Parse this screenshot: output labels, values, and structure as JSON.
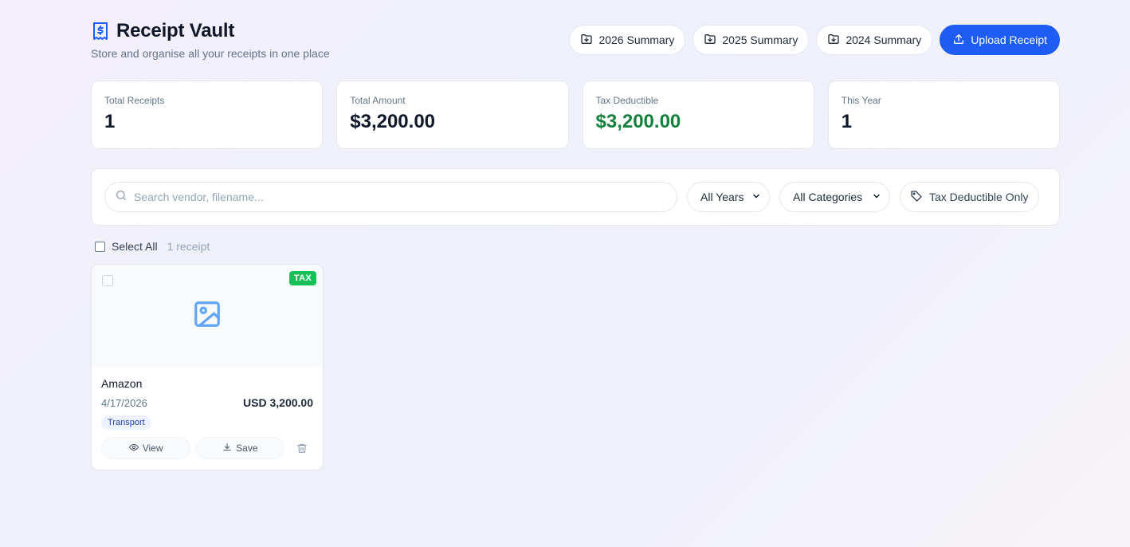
{
  "header": {
    "title": "Receipt Vault",
    "subtitle": "Store and organise all your receipts in one place",
    "summary_buttons": [
      {
        "label": "2026 Summary"
      },
      {
        "label": "2025 Summary"
      },
      {
        "label": "2024 Summary"
      }
    ],
    "upload_label": "Upload Receipt"
  },
  "stats": [
    {
      "label": "Total Receipts",
      "value": "1"
    },
    {
      "label": "Total Amount",
      "value": "$3,200.00"
    },
    {
      "label": "Tax Deductible",
      "value": "$3,200.00"
    },
    {
      "label": "This Year",
      "value": "1"
    }
  ],
  "filters": {
    "search_placeholder": "Search vendor, filename...",
    "year_select": "All Years",
    "category_select": "All Categories",
    "tax_toggle": "Tax Deductible Only"
  },
  "selection": {
    "select_all": "Select All",
    "count": "1 receipt"
  },
  "receipts": [
    {
      "badge": "TAX",
      "vendor": "Amazon",
      "date": "4/17/2026",
      "amount": "USD 3,200.00",
      "category": "Transport",
      "view_label": "View",
      "save_label": "Save"
    }
  ],
  "colors": {
    "primary": "#1d5cf5",
    "tax_green": "#16c257",
    "deductible_text": "#15803d",
    "icon_blue": "#60a5fa"
  }
}
